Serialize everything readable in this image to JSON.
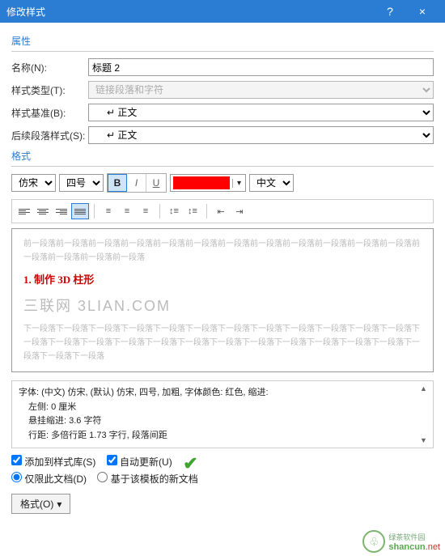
{
  "titlebar": {
    "title": "修改样式",
    "help": "?",
    "close": "×"
  },
  "sections": {
    "properties": "属性",
    "format": "格式"
  },
  "props": {
    "name_label": "名称(N):",
    "name_value": "标题 2",
    "type_label": "样式类型(T):",
    "type_value": "链接段落和字符",
    "base_label": "样式基准(B):",
    "base_value": "↵ 正文",
    "next_label": "后续段落样式(S):",
    "next_value": "↵ 正文"
  },
  "fmt": {
    "font": "仿宋",
    "size": "四号",
    "bold": "B",
    "italic": "I",
    "underline": "U",
    "color": "#ff0000",
    "lang": "中文"
  },
  "preview": {
    "filler_before": "前一段落前一段落前一段落前一段落前一段落前一段落前一段落前一段落前一段落前一段落前一段落前一段落前一段落前一段落前一段落前一段落",
    "heading": "1. 制作 3D 柱形",
    "watermark": "三联网 3LIAN.COM",
    "filler_after": "下一段落下一段落下一段落下一段落下一段落下一段落下一段落下一段落下一段落下一段落下一段落下一段落下一段落下一段落下一段落下一段落下一段落下一段落下一段落下一段落下一段落下一段落下一段落下一段落下一段落下一段落下一段落"
  },
  "desc": {
    "l1": "字体: (中文) 仿宋, (默认) 仿宋, 四号, 加粗, 字体颜色: 红色, 缩进:",
    "l2": "左侧:  0 厘米",
    "l3": "悬挂缩进: 3.6 字符",
    "l4": "行距: 多倍行距 1.73 字行, 段落间距"
  },
  "opts": {
    "add_gallery": "添加到样式库(S)",
    "auto_update": "自动更新(U)",
    "this_doc": "仅限此文档(D)",
    "template": "基于该模板的新文档"
  },
  "format_btn": "格式(O)",
  "footer": {
    "site": "shancun",
    "tld": ".net",
    "brand": "绿茶软件园"
  }
}
